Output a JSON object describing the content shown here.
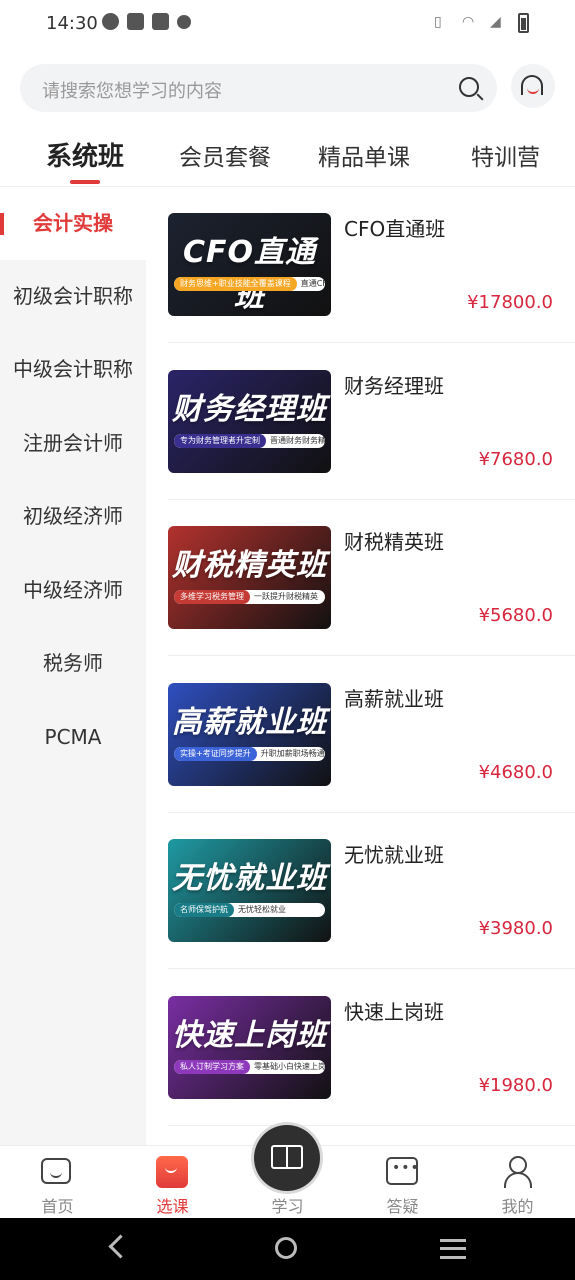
{
  "status": {
    "time": "14:30"
  },
  "search": {
    "placeholder": "请搜索您想学习的内容"
  },
  "tabs": [
    {
      "label": "系统班",
      "active": true
    },
    {
      "label": "会员套餐"
    },
    {
      "label": "精品单课"
    },
    {
      "label": "特训营"
    }
  ],
  "sidebar": {
    "items": [
      {
        "label": "会计实操",
        "active": true
      },
      {
        "label": "初级会计职称"
      },
      {
        "label": "中级会计职称"
      },
      {
        "label": "注册会计师"
      },
      {
        "label": "初级经济师"
      },
      {
        "label": "中级经济师"
      },
      {
        "label": "税务师"
      },
      {
        "label": "PCMA"
      }
    ]
  },
  "courses": [
    {
      "name": "CFO直通班",
      "price": "¥17800.0",
      "thumb_title": "CFO直通班",
      "tag_left": "财务思维+职业技能全覆盖课程",
      "tag_right": "直通CFO财务巅峰",
      "bg": "#1c2230",
      "hl": "#f5a623"
    },
    {
      "name": "财务经理班",
      "price": "¥7680.0",
      "thumb_title": "财务经理班",
      "tag_left": "专为财务管理者升定制",
      "tag_right": "晋通财务财务精英必学",
      "bg": "#2b2468",
      "hl": "#3a2f8f"
    },
    {
      "name": "财税精英班",
      "price": "¥5680.0",
      "thumb_title": "财税精英班",
      "tag_left": "多维学习税务管理",
      "tag_right": "一跃提升财税精英",
      "bg": "#b3322e",
      "hl": "#c43b36"
    },
    {
      "name": "高薪就业班",
      "price": "¥4680.0",
      "thumb_title": "高薪就业班",
      "tag_left": "实操+考证同步提升",
      "tag_right": "升职加薪职场畅通无阻",
      "bg": "#2f4fbf",
      "hl": "#3d63d8"
    },
    {
      "name": "无忧就业班",
      "price": "¥3980.0",
      "thumb_title": "无忧就业班",
      "tag_left": "名师保驾护航",
      "tag_right": "无忧轻松就业",
      "bg": "#1f9aa3",
      "hl": "#1a7c86"
    },
    {
      "name": "快速上岗班",
      "price": "¥1980.0",
      "thumb_title": "快速上岗班",
      "tag_left": "私人订制学习方案",
      "tag_right": "零基础小白快速上岗!",
      "bg": "#7a2ea3",
      "hl": "#8e39bb"
    }
  ],
  "tabbar": [
    {
      "label": "首页",
      "icon": "home-icon"
    },
    {
      "label": "选课",
      "icon": "shopping-bag-icon",
      "active": true
    },
    {
      "label": "学习",
      "icon": "book-icon"
    },
    {
      "label": "答疑",
      "icon": "chat-icon"
    },
    {
      "label": "我的",
      "icon": "user-icon"
    }
  ],
  "colors": {
    "accent": "#e03a3a",
    "price": "#d7263d"
  }
}
